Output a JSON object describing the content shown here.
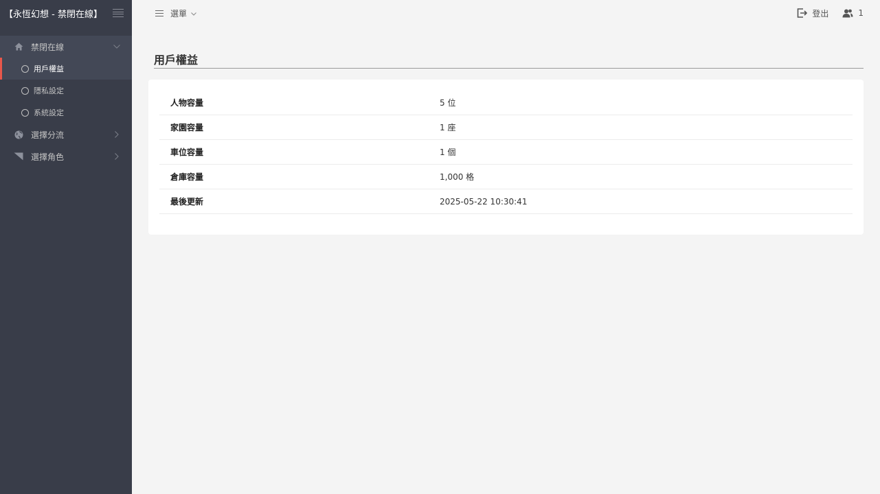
{
  "sidebar": {
    "brand": "【永恆幻想 - 禁閉在線】",
    "group_main": {
      "label": "禁閉在線",
      "icon": "home-icon"
    },
    "sub_items": [
      {
        "label": "用戶權益"
      },
      {
        "label": "隱私設定"
      },
      {
        "label": "系統設定"
      }
    ],
    "group_branch": {
      "label": "選擇分流",
      "icon": "globe-icon"
    },
    "group_role": {
      "label": "選擇角色",
      "icon": "flag-icon"
    }
  },
  "topbar": {
    "menu_label": "選單",
    "logout_label": "登出",
    "user_count": "1"
  },
  "page": {
    "title": "用戶權益"
  },
  "rows": [
    {
      "key": "人物容量",
      "value": "5 位"
    },
    {
      "key": "家園容量",
      "value": "1 座"
    },
    {
      "key": "車位容量",
      "value": "1 個"
    },
    {
      "key": "倉庫容量",
      "value": "1,000 格"
    },
    {
      "key": "最後更新",
      "value": "2025-05-22 10:30:41"
    }
  ],
  "colors": {
    "sidebar_bg": "#393d49",
    "active_accent": "#e8574b",
    "page_bg": "#f4f4f4"
  }
}
